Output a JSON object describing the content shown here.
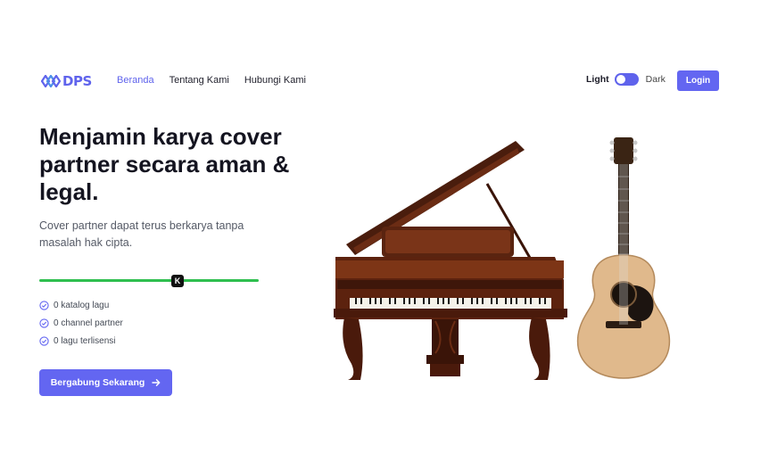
{
  "brand": {
    "logo_text": "DPS"
  },
  "nav": {
    "links": [
      {
        "label": "Beranda",
        "active": true
      },
      {
        "label": "Tentang Kami",
        "active": false
      },
      {
        "label": "Hubungi Kami",
        "active": false
      }
    ]
  },
  "theme": {
    "light_label": "Light",
    "dark_label": "Dark",
    "mode": "light"
  },
  "auth": {
    "login_label": "Login"
  },
  "hero": {
    "title": "Menjamin karya cover partner secara aman & legal.",
    "subtitle": "Cover partner dapat terus berkarya tanpa masalah hak cipta.",
    "slider": {
      "handle_glyph": "K",
      "level": 0.63
    },
    "stats": [
      {
        "label": "0 katalog lagu",
        "icon": "check-circle-icon"
      },
      {
        "label": "0 channel partner",
        "icon": "check-circle-icon"
      },
      {
        "label": "0 lagu terlisensi",
        "icon": "check-circle-icon"
      }
    ],
    "cta_label": "Bergabung Sekarang",
    "cta_icon": "arrow-right-icon",
    "illustration": "piano-and-guitar-image"
  },
  "colors": {
    "accent": "#6366f1",
    "slider": "#2fbf4f",
    "text": "#141420"
  }
}
